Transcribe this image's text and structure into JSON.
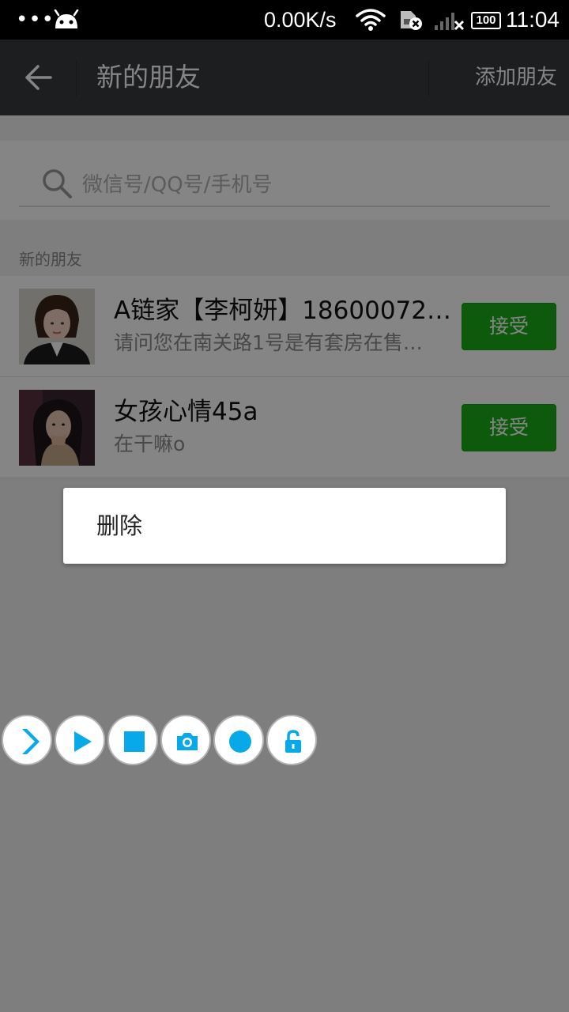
{
  "status_bar": {
    "dots": "•••",
    "net_speed": "0.00K/s",
    "battery": "100",
    "time": "11:04",
    "icons": [
      "android-icon",
      "wifi-icon",
      "sim-error-icon",
      "signal-no-service-icon",
      "battery-icon"
    ]
  },
  "title_bar": {
    "title": "新的朋友",
    "action": "添加朋友",
    "back_icon": "back-arrow-icon",
    "color": "#393a3f"
  },
  "search": {
    "placeholder": "微信号/QQ号/手机号",
    "value": ""
  },
  "section_label": "新的朋友",
  "requests": [
    {
      "name": "A链家【李柯妍】18600072…",
      "message": "请问您在南关路1号是有套房在售…",
      "button": "接受"
    },
    {
      "name": "女孩心情45a",
      "message": "在干嘛o",
      "button": "接受"
    }
  ],
  "context_menu": {
    "items": [
      "删除"
    ]
  },
  "floating_toolbar": {
    "buttons": [
      "chevron-right-icon",
      "play-icon",
      "stop-icon",
      "camera-icon",
      "record-icon",
      "unlock-icon"
    ],
    "accent": "#08a9e9"
  },
  "colors": {
    "accept_green": "#1aad19",
    "overlay": "rgba(0,0,0,0.48)"
  }
}
